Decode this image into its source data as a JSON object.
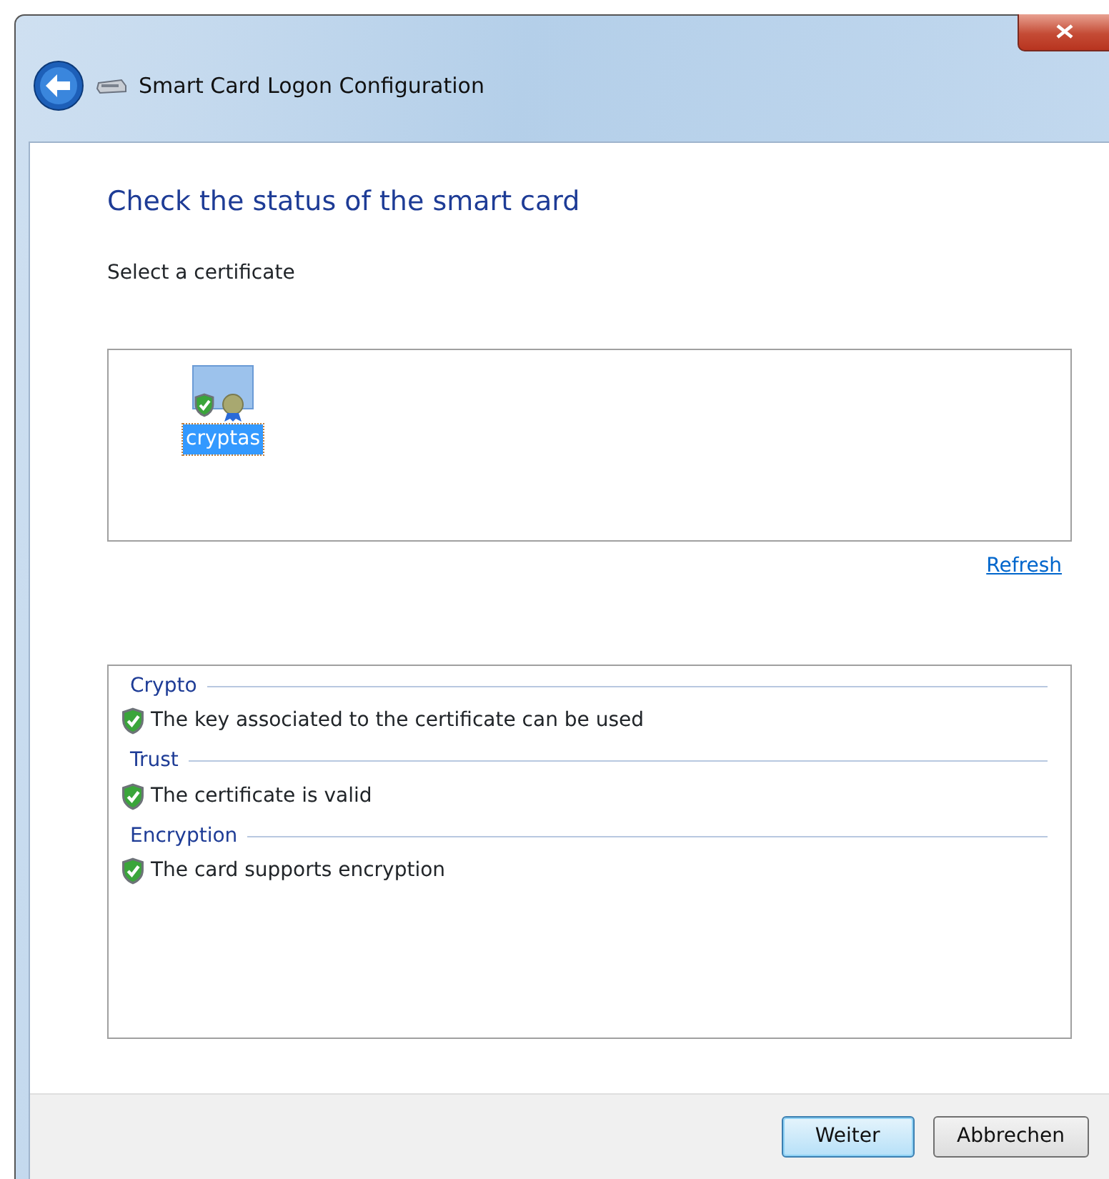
{
  "window": {
    "title": "Smart Card Logon Configuration"
  },
  "heading": "Check the status of the smart card",
  "prompt": "Select a certificate",
  "certificates": [
    {
      "label": "cryptas",
      "selected": true
    }
  ],
  "refresh_link": "Refresh",
  "status_groups": [
    {
      "title": "Crypto",
      "items": [
        "The key associated to the certificate can be used"
      ]
    },
    {
      "title": "Trust",
      "items": [
        "The certificate is valid"
      ]
    },
    {
      "title": "Encryption",
      "items": [
        "The card supports encryption"
      ]
    }
  ],
  "buttons": [
    {
      "label": "Weiter",
      "default": true
    },
    {
      "label": "Abbrechen",
      "default": false
    }
  ]
}
